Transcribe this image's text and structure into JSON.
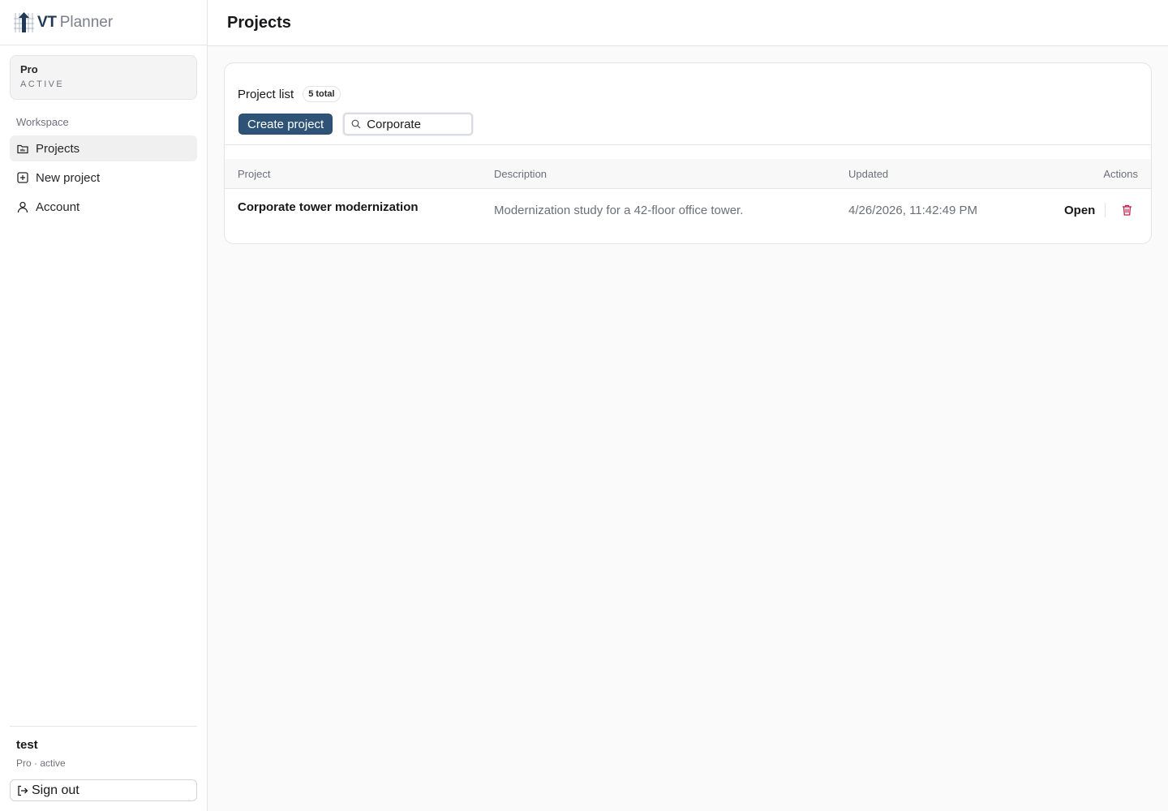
{
  "brand": {
    "vt": "VT",
    "planner": "Planner"
  },
  "plan": {
    "name": "Pro",
    "status": "ACTIVE"
  },
  "sidebar": {
    "section_label": "Workspace",
    "items": [
      {
        "label": "Projects",
        "icon": "folder-icon",
        "active": true
      },
      {
        "label": "New project",
        "icon": "plus-square-icon",
        "active": false
      },
      {
        "label": "Account",
        "icon": "user-icon",
        "active": false
      }
    ]
  },
  "user": {
    "name": "test",
    "subtitle": "Pro · active"
  },
  "signout": {
    "label": "Sign out",
    "icon": "sign-out-icon"
  },
  "header": {
    "title": "Projects"
  },
  "projects": {
    "list_title": "Project list",
    "total_badge": "5 total",
    "create_label": "Create project",
    "search_value": "Corporate",
    "search_icon": "search-icon",
    "columns": [
      "Project",
      "Description",
      "Updated",
      "Actions"
    ],
    "rows": [
      {
        "name": "Corporate tower modernization",
        "description": "Modernization study for a 42-floor office tower.",
        "updated": "4/26/2026, 11:42:49 PM",
        "open_label": "Open",
        "delete_icon": "trash-icon"
      }
    ]
  },
  "colors": {
    "accent": "#2f5377",
    "danger": "#c0224c",
    "brand": "#203a56"
  }
}
